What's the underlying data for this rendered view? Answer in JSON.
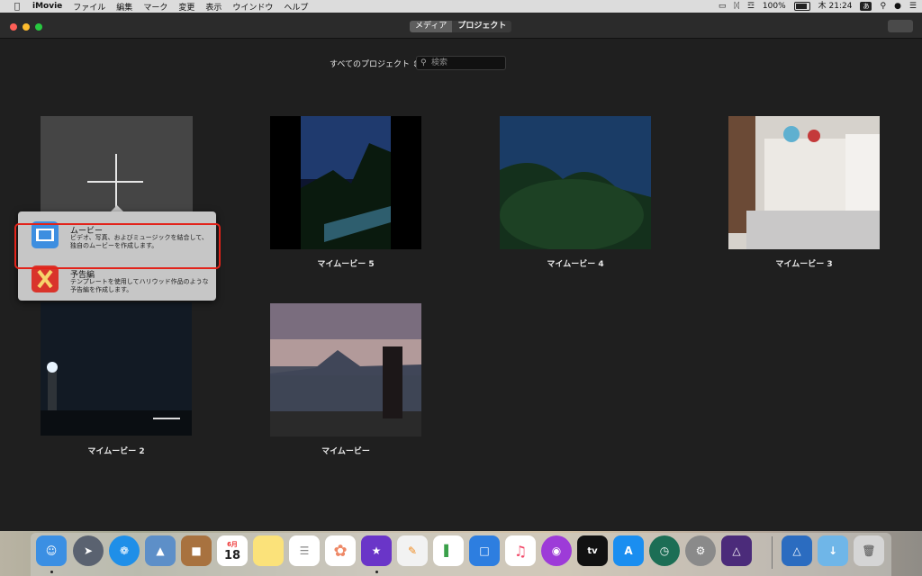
{
  "menubar": {
    "app": "iMovie",
    "items": [
      "ファイル",
      "編集",
      "マーク",
      "変更",
      "表示",
      "ウインドウ",
      "ヘルプ"
    ],
    "battery": "100%",
    "input_mode": "あ",
    "clock": "木 21:24"
  },
  "titlebar": {
    "tabs": [
      "メディア",
      "プロジェクト"
    ],
    "selected_tab": "メディア"
  },
  "browser": {
    "filter": "すべてのプロジェクト",
    "search_placeholder": "検索"
  },
  "projects": [
    {
      "name": "マイムービー 5"
    },
    {
      "name": "マイムービー 4"
    },
    {
      "name": "マイムービー 3"
    },
    {
      "name": "マイムービー 2"
    },
    {
      "name": "マイムービー"
    }
  ],
  "popover": {
    "items": [
      {
        "title": "ムービー",
        "description": "ビデオ、写真、およびミュージックを結合して、独自のムービーを作成します。"
      },
      {
        "title": "予告編",
        "description": "テンプレートを使用してハリウッド作品のような予告編を作成します。"
      }
    ]
  },
  "dock": {
    "calendar_month": "6月",
    "calendar_day": "18",
    "tv_label": "tv"
  },
  "colors": {
    "window_bg": "#1f1f1f",
    "highlight": "#e2231a",
    "popover_bg": "#c6c6c6"
  }
}
